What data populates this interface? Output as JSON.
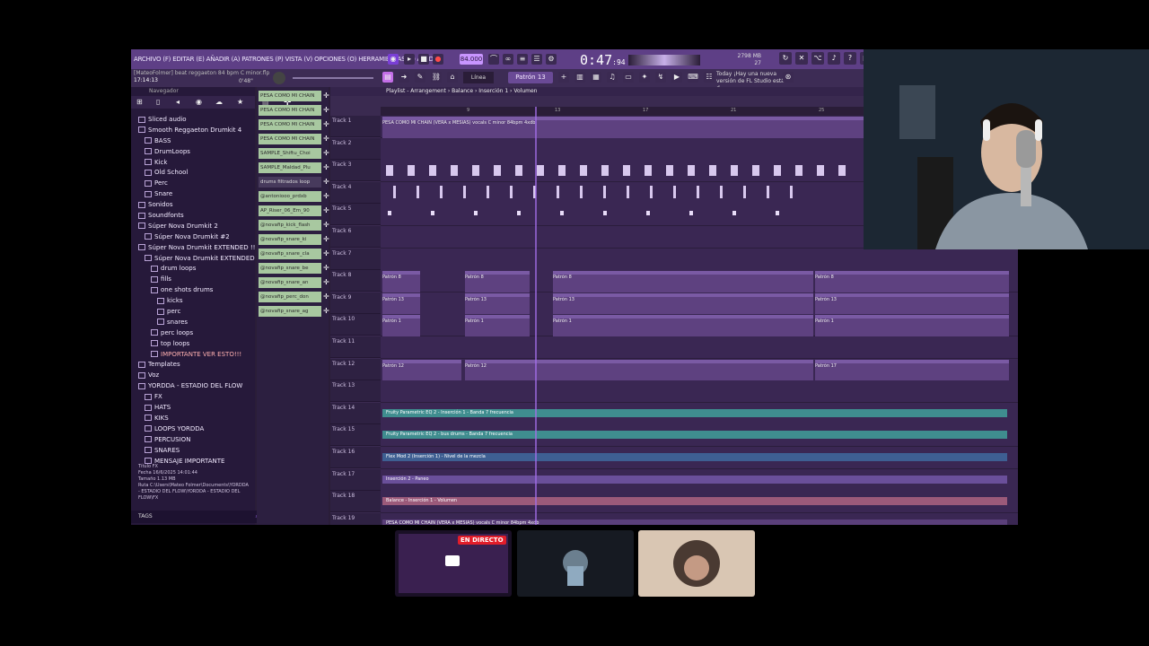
{
  "menubar": {
    "menus": "ARCHIVO (F) EDITAR (E) AÑADIR (A) PATRONES (P) VISTA (V) OPCIONES (O) HERRAMIENTAS (T) AYUDA"
  },
  "transport": {
    "bpm": "84.000",
    "time_main": "0:47",
    "time_sub": "94",
    "mem": "2798 MB",
    "cpu": "27"
  },
  "toolbar2": {
    "song_title": "[MateoFolmer] beat reggaeton 84 bpm C minor.flp",
    "song_time": "17:14:13",
    "song_pos": "0'48\"",
    "mode": "Línea",
    "pattern": "Patrón 13",
    "news_line1": "Today ¡Hay una nueva",
    "news_line2": "versión de FL Studio está d"
  },
  "browser": {
    "header": "Navegador",
    "items": [
      {
        "label": "Sliced audio",
        "indent": 0
      },
      {
        "label": "Smooth Reggaeton Drumkit 4",
        "indent": 0
      },
      {
        "label": "BASS",
        "indent": 1
      },
      {
        "label": "DrumLoops",
        "indent": 1
      },
      {
        "label": "Kick",
        "indent": 1
      },
      {
        "label": "Old School",
        "indent": 1
      },
      {
        "label": "Perc",
        "indent": 1
      },
      {
        "label": "Snare",
        "indent": 1
      },
      {
        "label": "Sonidos",
        "indent": 0
      },
      {
        "label": "Soundfonts",
        "indent": 0
      },
      {
        "label": "Súper Nova Drumkit 2",
        "indent": 0
      },
      {
        "label": "Súper Nova Drumkit #2",
        "indent": 1
      },
      {
        "label": "Súper Nova Drumkit EXTENDED !!",
        "indent": 0
      },
      {
        "label": "Súper Nova Drumkit EXTENDED !!",
        "indent": 1
      },
      {
        "label": "drum loops",
        "indent": 2
      },
      {
        "label": "fills",
        "indent": 2
      },
      {
        "label": "one shots drums",
        "indent": 2
      },
      {
        "label": "kicks",
        "indent": 3
      },
      {
        "label": "perc",
        "indent": 3
      },
      {
        "label": "snares",
        "indent": 3
      },
      {
        "label": "perc loops",
        "indent": 2
      },
      {
        "label": "top loops",
        "indent": 2
      },
      {
        "label": "IMPORTANTE VER ESTO!!!",
        "indent": 2,
        "hl": true
      },
      {
        "label": "Templates",
        "indent": 0
      },
      {
        "label": "Voz",
        "indent": 0
      },
      {
        "label": "YORDDA - ESTADIO DEL FLOW",
        "indent": 0
      },
      {
        "label": "FX",
        "indent": 1
      },
      {
        "label": "HATS",
        "indent": 1
      },
      {
        "label": "KIKS",
        "indent": 1
      },
      {
        "label": "LOOPS YORDDA",
        "indent": 1
      },
      {
        "label": "PERCUSION",
        "indent": 1
      },
      {
        "label": "SNARES",
        "indent": 1
      },
      {
        "label": "MENSAJE IMPORTANTE",
        "indent": 1
      }
    ],
    "fileinfo": {
      "titulo_label": "Título",
      "titulo": "FX",
      "fecha_label": "Fecha",
      "fecha": "16/6/2025 14:01:44",
      "tamano_label": "Tamaño",
      "tamano": "1.13 MB",
      "ruta_label": "Ruta",
      "ruta": "C:\\Users\\Mateo Folmer\\Documents\\YORDDA - ESTADIO DEL FLOW\\YORDDA - ESTADIO DEL FLOW\\FX"
    },
    "tags_label": "TAGS"
  },
  "channels": [
    {
      "label": "PESA COMO MI CHAIN",
      "style": "green"
    },
    {
      "label": "PESA COMO MI CHAIN",
      "style": "green"
    },
    {
      "label": "PESA COMO MI CHAIN",
      "style": "green"
    },
    {
      "label": "PESA COMO MI CHAIN",
      "style": "green"
    },
    {
      "label": "SAMPLE_Shiftu_Choi",
      "style": "green"
    },
    {
      "label": "SAMPLE_Maldad_Plu",
      "style": "green"
    },
    {
      "label": "drums filtrados loop",
      "style": "dark"
    },
    {
      "label": "@antoniooo_prdxb",
      "style": "green"
    },
    {
      "label": "AP_Riser_06_Em_90",
      "style": "green"
    },
    {
      "label": "@novafip_kick_flash",
      "style": "green"
    },
    {
      "label": "@novafip_snare_ki",
      "style": "green"
    },
    {
      "label": "@novafip_snare_cla",
      "style": "green"
    },
    {
      "label": "@novafip_snare_be",
      "style": "green"
    },
    {
      "label": "@novafip_snare_an",
      "style": "green"
    },
    {
      "label": "@novafip_perc_don",
      "style": "green"
    },
    {
      "label": "@novafip_snare_ag",
      "style": "green"
    }
  ],
  "playlist": {
    "breadcrumb": "Playlist - Arrangement › Balance › Inserción 1 › Volumen",
    "ruler": [
      "9",
      "13",
      "17",
      "21",
      "25"
    ],
    "tracks": [
      "Track 1",
      "Track 2",
      "Track 3",
      "Track 4",
      "Track 5",
      "Track 6",
      "Track 7",
      "Track 8",
      "Track 9",
      "Track 10",
      "Track 11",
      "Track 12",
      "Track 13",
      "Track 14",
      "Track 15",
      "Track 16",
      "Track 17",
      "Track 18",
      "Track 19"
    ],
    "clip_track1": "PESA COMO MI CHAIN (VERA x MESIAS) vocals C minor 84bpm 4xdb",
    "pattern_clips": {
      "track8": "Patrón 8",
      "track9": "Patrón 13",
      "track10": "Patrón 1",
      "track12": "Patrón 12",
      "track12b": "Patrón 12",
      "track12c": "Patrón 17"
    },
    "automation": {
      "t14": "Fruity Parametric EQ 2 - Inserción 1 - Banda 7 frecuencia",
      "t15": "Fruity Parametric EQ 2 - bus drums - Banda 7 frecuencia",
      "t16": "Flex Mod 2 (Inserción 1) - Nivel de la mezcla",
      "t17": "Inserción 2 - Paneo",
      "t18": "Balance - Inserción 1 - Volumen",
      "t19": "PESA COMO MI CHAIN (VERA x MESIAS) vocals C minor 84bpm 4xdb"
    }
  },
  "call": {
    "live_badge": "EN DIRECTO"
  }
}
